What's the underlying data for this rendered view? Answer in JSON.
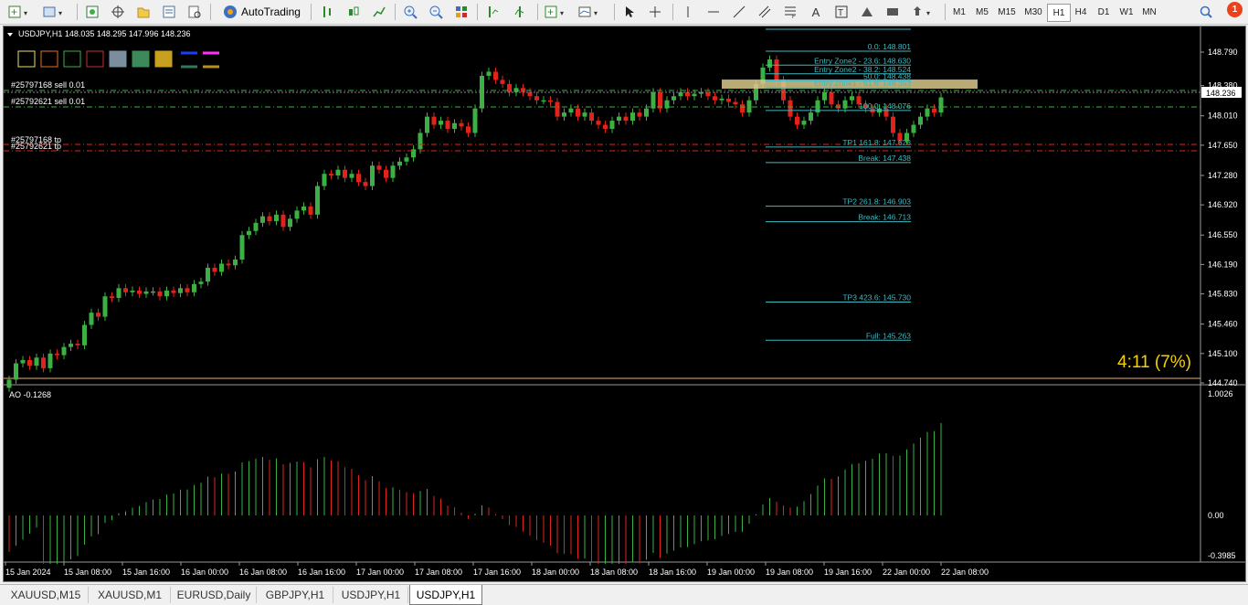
{
  "toolbar": {
    "autotrading_label": "AutoTrading",
    "timeframes": [
      "M1",
      "M5",
      "M15",
      "M30",
      "H1",
      "H4",
      "D1",
      "W1",
      "MN"
    ],
    "active_timeframe": "H1",
    "notification_count": "1"
  },
  "chart": {
    "header": "USDJPY,H1  148.035 148.295 147.996 148.236",
    "current_price": "148.236",
    "ratio_text": "4:11 (7%)",
    "price_ticks": [
      "148.790",
      "148.380",
      "148.010",
      "147.650",
      "147.280",
      "146.920",
      "146.550",
      "146.190",
      "145.830",
      "145.460",
      "145.100",
      "144.740"
    ],
    "time_ticks": [
      "15 Jan 2024",
      "15 Jan 08:00",
      "15 Jan 16:00",
      "16 Jan 00:00",
      "16 Jan 08:00",
      "16 Jan 16:00",
      "17 Jan 00:00",
      "17 Jan 08:00",
      "17 Jan 16:00",
      "18 Jan 00:00",
      "18 Jan 08:00",
      "18 Jan 16:00",
      "19 Jan 00:00",
      "19 Jan 08:00",
      "19 Jan 16:00",
      "22 Jan 00:00",
      "22 Jan 08:00"
    ],
    "order_labels": [
      "#25797168 sell 0.01",
      "#25792621 sell 0.01",
      "#25797168 tp",
      "#25792621 tp"
    ],
    "fib_labels": [
      {
        "text": "0.0: 148.801",
        "price": 148.801
      },
      {
        "text": "Entry Zone2 - 23.6: 148.630",
        "price": 148.63
      },
      {
        "text": "Entry Zone2 - 38.2: 148.524",
        "price": 148.524
      },
      {
        "text": "50.0: 148.438",
        "price": 148.438
      },
      {
        "text": "Entry Zone1 - 61.8: 148.353",
        "price": 148.353
      },
      {
        "text": "100.0: 148.076",
        "price": 148.076
      },
      {
        "text": "TP1 161.8: 147.628",
        "price": 147.628
      },
      {
        "text": "Break: 147.438",
        "price": 147.438
      },
      {
        "text": "TP2 261.8: 146.903",
        "price": 146.903
      },
      {
        "text": "Break: 146.713",
        "price": 146.713
      },
      {
        "text": "TP3 423.6: 145.730",
        "price": 145.73
      },
      {
        "text": "Full: 145.263",
        "price": 145.263
      }
    ],
    "ao_label": "AO -0.1268",
    "ao_ticks": [
      "1.0026",
      "0.00",
      "-0.3985"
    ],
    "colors": {
      "bull": "#3cb043",
      "bear": "#e0241c",
      "fib": "#3fb8c0",
      "zone": "#d8c98a",
      "ratio": "#f5d300"
    }
  },
  "tabs": [
    "XAUUSD,M15",
    "XAUUSD,M1",
    "EURUSD,Daily",
    "GBPJPY,H1",
    "USDJPY,H1",
    "USDJPY,H1"
  ],
  "active_tab": 5
}
